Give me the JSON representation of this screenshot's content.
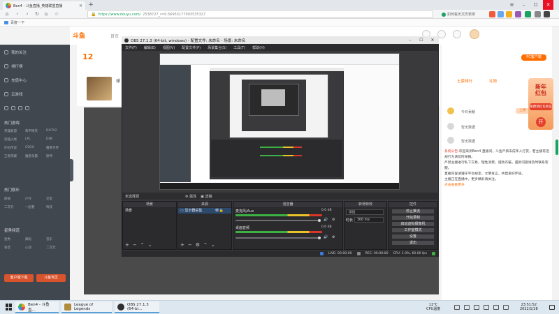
{
  "browser": {
    "tab_title": "Ben4 - 斗鱼直播_英雄联盟直播",
    "url_host": "https://www.douyu.com/",
    "url_path": "2538727_r=0.56953177093535327",
    "search_placeholder": "如何看天文历表排",
    "bookmark_label": "百度一下"
  },
  "douyu": {
    "logo": "斗鱼",
    "nav_item": "首页",
    "room_number": "12",
    "anchor_name": "球",
    "sidebar": {
      "items": [
        "我的关注",
        "排行榜",
        "充值中心",
        "云游戏"
      ],
      "sections": [
        {
          "title": "热门游戏",
          "games": [
            "英雄联盟",
            "和平精英",
            "DOTA2",
            "穿越火线",
            "LPL",
            "DNF",
            "炉石传说",
            "CSGO",
            "魔兽世界",
            "王者荣耀",
            "魔兽争霸",
            "原神"
          ]
        },
        {
          "title": "热门娱乐",
          "games": [
            "颜值",
            "户外",
            "交友",
            "二次元",
            "一起看",
            "科技"
          ]
        },
        {
          "title": "星秀频道",
          "games": [
            "星秀",
            "舞蹈",
            "音乐",
            "语音",
            "心动",
            "二次元"
          ]
        }
      ],
      "buttons": [
        "客户端下载",
        "斗鱼专区"
      ]
    },
    "right": {
      "pc_badge": "PC客户端",
      "tabs": [
        "土豪排行",
        "礼物"
      ],
      "rank": [
        "今日贡献",
        "暂无数据",
        "暂无数据"
      ],
      "rank_btn": "上榜",
      "promo_line1": "新年",
      "promo_line2": "红包",
      "promo_btn": "免费领红包奖品",
      "promo_coin": "开",
      "chat": [
        {
          "label": "系统公告:",
          "text": "欢迎来到Ben4 直播间，斗鱼严禁未成年人打赏，若主播有违规行为请及时举报。"
        },
        {
          "label": "",
          "text": "严禁主播进行私下交易，理性消费，谨防诈骗，遇到问题请及时联系客服。"
        },
        {
          "label": "",
          "text": "直播内容请遵守平台规定，文明发言，共建良好环境。"
        },
        {
          "label": "",
          "text": "主播正在直播中，更多精彩请关注。"
        }
      ],
      "chat_link": "点击查看更多"
    }
  },
  "obs": {
    "title": "OBS 27.1.3 (64-bit, windows) - 配置文件: 未命名 - 场景: 未命名",
    "menu": [
      "文件(F)",
      "编辑(E)",
      "视图(V)",
      "配置文件(P)",
      "场景集合(S)",
      "工具(T)",
      "帮助(H)"
    ],
    "preview_label": "未选择源",
    "toolbar": [
      "属性",
      "滤镜"
    ],
    "docks": {
      "scenes": {
        "title": "场景",
        "items": [
          "场景"
        ]
      },
      "sources": {
        "title": "来源",
        "items": [
          "显示器采集"
        ]
      },
      "mixer": {
        "title": "混音器",
        "tracks": [
          {
            "name": "麦克风/Aux",
            "value": "0.0 dB"
          },
          {
            "name": "桌面音频",
            "value": "0.0 dB"
          }
        ]
      },
      "transitions": {
        "title": "转场特效",
        "type": "淡出",
        "duration_label": "时长",
        "duration": "300 ms"
      },
      "controls": {
        "title": "控件",
        "buttons": [
          "停止推流",
          "开始录制",
          "启动虚拟摄像机",
          "工作室模式",
          "设置",
          "退出"
        ]
      }
    },
    "status": {
      "live": "LIVE: 00:00:00",
      "rec": "REC: 00:00:00",
      "cpu": "CPU: 1.0%, 60.00 fps"
    }
  },
  "taskbar": {
    "tasks": [
      "Ben4 - 斗鱼直...",
      "League of Legends",
      "OBS 27.1.3 (64-bi..."
    ],
    "weather_temp": "12°C",
    "weather_text": "CPU温度",
    "time": "23:51:52",
    "date": "2022/1/28"
  }
}
